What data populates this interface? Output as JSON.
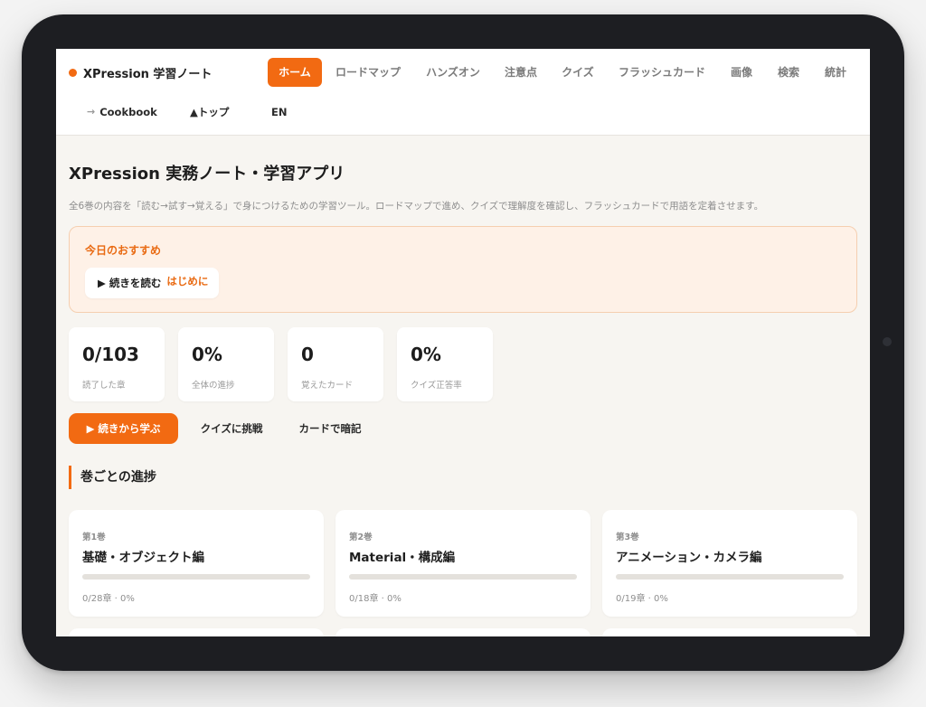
{
  "app": {
    "brand": "XPression 学習ノート"
  },
  "nav": {
    "tabs": [
      {
        "label": "ホーム",
        "active": true
      },
      {
        "label": "ロードマップ",
        "active": false
      },
      {
        "label": "ハンズオン",
        "active": false
      },
      {
        "label": "注意点",
        "active": false
      },
      {
        "label": "クイズ",
        "active": false
      },
      {
        "label": "フラッシュカード",
        "active": false
      },
      {
        "label": "画像",
        "active": false
      },
      {
        "label": "検索",
        "active": false
      },
      {
        "label": "統計",
        "active": false
      }
    ],
    "secondary": [
      {
        "label": "Cookbook",
        "icon": "wrench-icon"
      },
      {
        "label": "▲トップ",
        "icon": ""
      },
      {
        "label": "EN",
        "icon": ""
      }
    ]
  },
  "page": {
    "title": "XPression 実務ノート・学習アプリ",
    "description": "全6巻の内容を「読む→試す→覚える」で身につけるための学習ツール。ロードマップで進め、クイズで理解度を確認し、フラッシュカードで用語を定着させます。"
  },
  "recommendation": {
    "heading": "今日のおすすめ",
    "button_label": "▶ 続きを読む",
    "link_label": "はじめに"
  },
  "stats": [
    {
      "value": "0/103",
      "label": "読了した章"
    },
    {
      "value": "0%",
      "label": "全体の進捗"
    },
    {
      "value": "0",
      "label": "覚えたカード"
    },
    {
      "value": "0%",
      "label": "クイズ正答率"
    }
  ],
  "actions": {
    "continue": "▶ 続きから学ぶ",
    "quiz": "クイズに挑戦",
    "cards": "カードで暗記"
  },
  "volumes_section": {
    "title": "巻ごとの進捗",
    "volumes": [
      {
        "no": "第1巻",
        "title": "基礎・オブジェクト編",
        "progress_text": "0/28章 · 0%",
        "progress": 0
      },
      {
        "no": "第2巻",
        "title": "Material・構成編",
        "progress_text": "0/18章 · 0%",
        "progress": 0
      },
      {
        "no": "第3巻",
        "title": "アニメーション・カメラ編",
        "progress_text": "0/19章 · 0%",
        "progress": 0
      }
    ]
  },
  "colors": {
    "accent": "#f26a12",
    "accent_soft": "#fef1e7",
    "page_background": "#f7f5f1",
    "device_frame": "#1d1e22"
  }
}
